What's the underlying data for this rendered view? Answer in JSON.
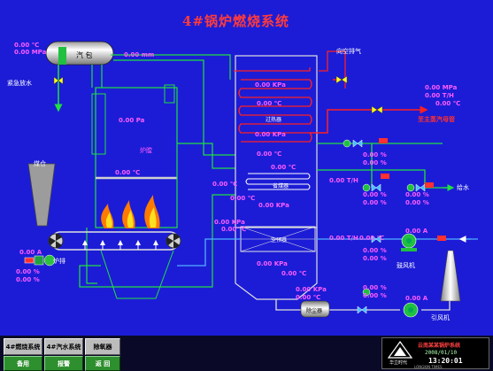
{
  "title": "4#锅炉燃烧系统",
  "drum": {
    "label": "汽 包",
    "temp": "0.00 ℃",
    "pressure": "0.00 MPa",
    "level": "0.00 mm"
  },
  "labels": {
    "emergency_drain": "紧急放水",
    "coal_hopper": "煤仓",
    "furnace": "炉膛",
    "vent_to_atmosphere": "向空排气",
    "superheater": "过热器",
    "economizer": "省煤器",
    "air_preheater": "空预器",
    "main_steam": "至主蒸汽母管",
    "feedwater": "给水",
    "grate": "炉排",
    "fd_fan": "鼓风机",
    "id_fan": "引风机",
    "dust_collector": "除尘器"
  },
  "readings": {
    "furnace_pressure": "0.00 Pa",
    "furnace_temp": "0.00 ℃",
    "left_temp": "0.00 ℃",
    "sh_pressure_top": "0.00 KPa",
    "sh_temp_top": "0.00 ℃",
    "sh_pressure_mid": "0.00 KPa",
    "sh_temp_mid": "0.00 ℃",
    "econ_in_temp": "0.00 ℃",
    "econ_out_temp": "0.00 ℃",
    "econ_pressure": "0.00 KPa",
    "ap_pressure": "0.00 KPa",
    "ap_temp": "0.00 ℃",
    "ap_flow": "0.00 T/H",
    "ap_air_temp": "0.00 ℃",
    "duct_pressure": "0.00 KPa",
    "duct_temp": "0.00 ℃",
    "steam_pressure": "0.00 MPa",
    "steam_flow": "0.00 T/H",
    "steam_temp": "0.00 ℃",
    "fw_flow": "0.00 T/H",
    "fw_valve_a1": "0.00 %",
    "fw_valve_a2": "0.00 %",
    "fw_valve_b1": "0.00 %",
    "fw_valve_b2": "0.00 %",
    "fw_valve_c1": "0.00 %",
    "fw_valve_c2": "0.00 %",
    "fd_current": "0.00 A",
    "fd_damper1": "0.00 %",
    "fd_damper2": "0.00 %",
    "id_current": "0.00 A",
    "id_damper1": "0.00 %",
    "id_damper2": "0.00 %",
    "dc_pressure": "0.00 KPa",
    "dc_temp": "0.00 ℃",
    "grate_current": "0.00 A",
    "grate_speed1": "0.00 %",
    "grate_speed2": "0.00 %"
  },
  "nav": {
    "combustion": "4#燃烧系统",
    "steam_water": "4#汽水系统",
    "dust_removal": "除氧器",
    "standby": "备用",
    "alarm": "报警",
    "back": "返 回"
  },
  "footer": {
    "company": "云南某某锅炉系统",
    "date": "2008/01/10",
    "time": "13:20:01",
    "brand": "华立时代",
    "brand_sub": "LONGKIN TIMES"
  },
  "colors": {
    "background": "#1c1cd6",
    "steam": "#ff2020",
    "water": "#20e040",
    "air": "#50b0ff",
    "value": "#ff5cff"
  }
}
